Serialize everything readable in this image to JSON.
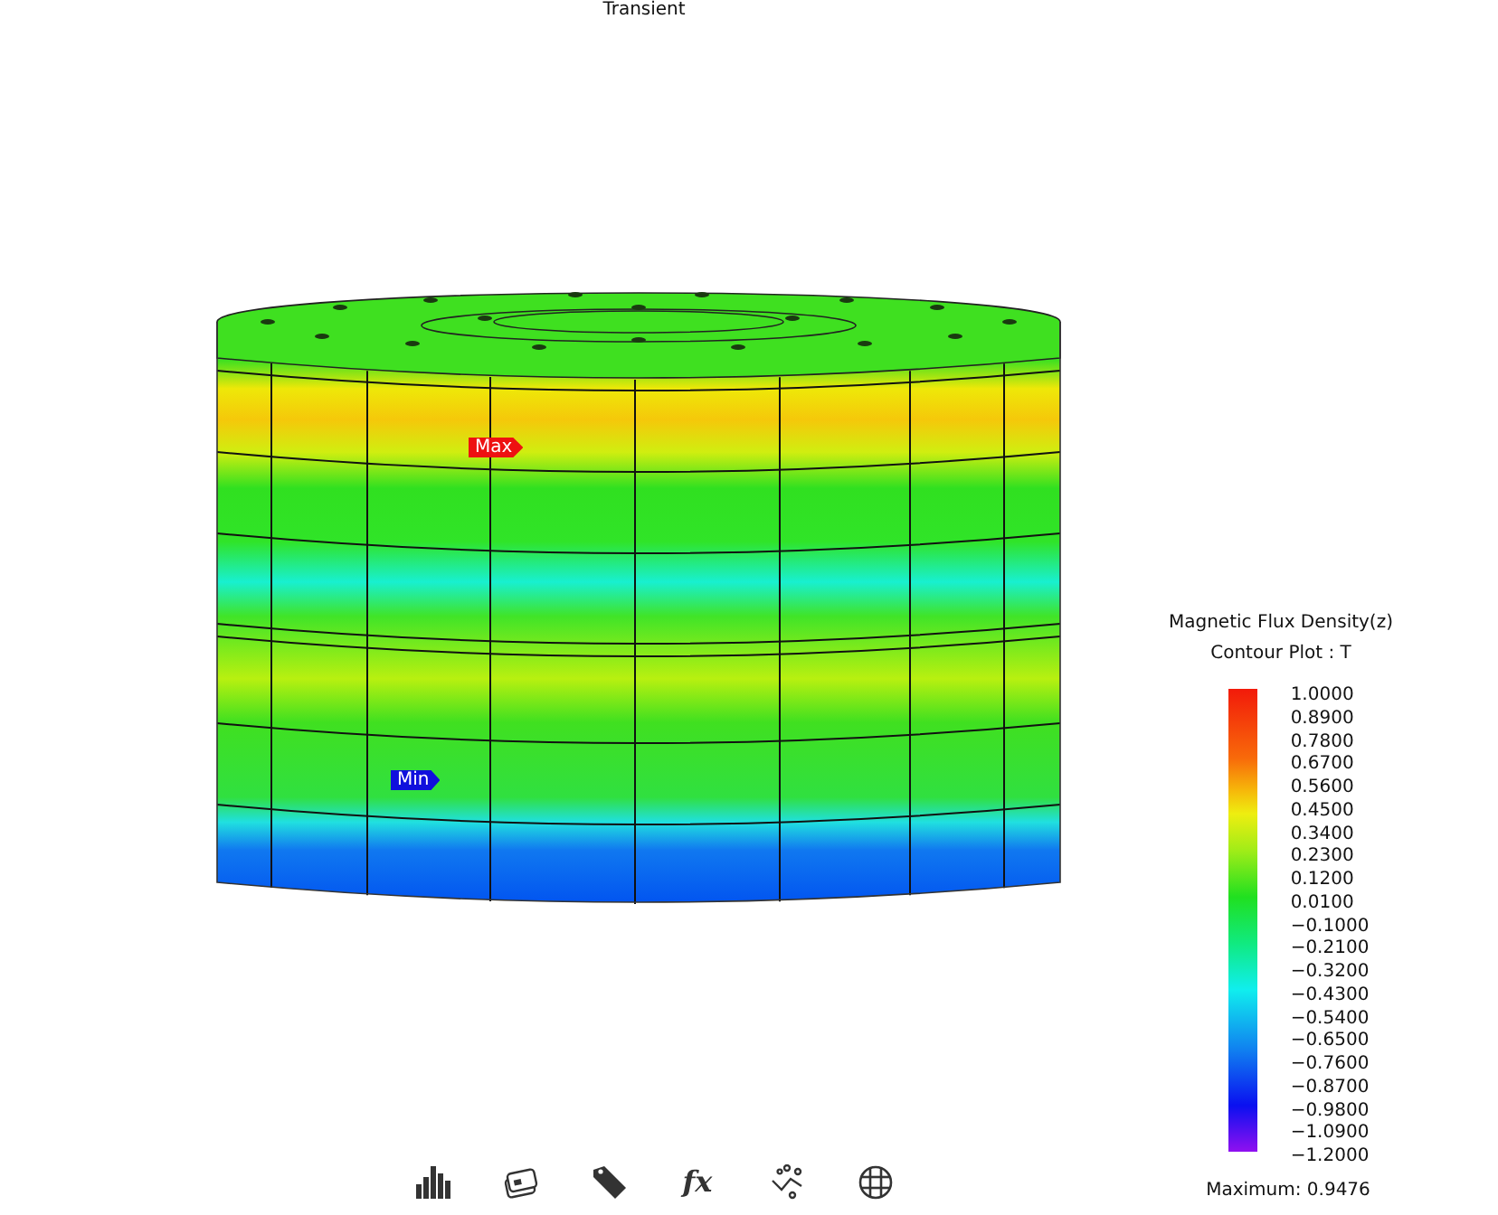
{
  "view_title": "Transient",
  "markers": [
    {
      "label": "Max",
      "color": "#ee1111"
    },
    {
      "label": "Min",
      "color": "#1010dd"
    }
  ],
  "legend": {
    "title": "Magnetic Flux Density(z)",
    "subtitle": "Contour Plot : T",
    "levels": [
      "1.0000",
      "0.8900",
      "0.7800",
      "0.6700",
      "0.5600",
      "0.4500",
      "0.3400",
      "0.2300",
      "0.1200",
      "0.0100",
      "−0.1000",
      "−0.2100",
      "−0.3200",
      "−0.4300",
      "−0.5400",
      "−0.6500",
      "−0.7600",
      "−0.8700",
      "−0.9800",
      "−1.0900",
      "−1.2000"
    ],
    "maximum": "Maximum: 0.9476"
  },
  "toolbar": [
    {
      "kind": "bars"
    },
    {
      "kind": "cards"
    },
    {
      "kind": "tag"
    },
    {
      "kind": "text",
      "label": "fx"
    },
    {
      "kind": "scatter"
    },
    {
      "kind": "grid"
    }
  ]
}
